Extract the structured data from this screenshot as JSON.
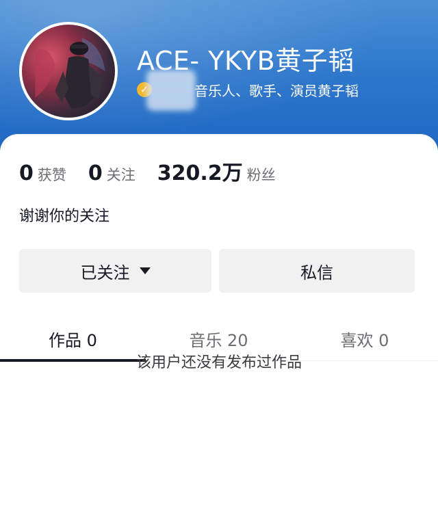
{
  "profile": {
    "display_name": "ACE- YKYB黄子韬",
    "verified_icon": "verified-check-icon",
    "verified_text": "音乐人、歌手、演员黄子韬",
    "colors": {
      "header": "#2f78cc",
      "badge": "#f5b82e"
    }
  },
  "stats": [
    {
      "value": "0",
      "label": "获赞"
    },
    {
      "value": "0",
      "label": "关注"
    },
    {
      "value": "320.2万",
      "label": "粉丝"
    }
  ],
  "bio": "谢谢你的关注",
  "actions": {
    "follow_label": "已关注",
    "follow_icon": "caret-down-icon",
    "message_label": "私信"
  },
  "tabs": [
    {
      "label": "作品 0",
      "active": true
    },
    {
      "label": "音乐 20",
      "active": false
    },
    {
      "label": "喜欢 0",
      "active": false
    }
  ],
  "empty_state": "该用户还没有发布过作品"
}
